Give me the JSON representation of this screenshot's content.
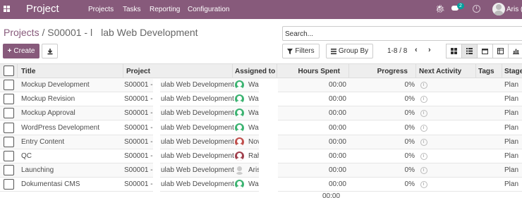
{
  "navbar": {
    "brand": "Project",
    "menu": [
      {
        "label": "Projects"
      },
      {
        "label": "Tasks"
      },
      {
        "label": "Reporting"
      },
      {
        "label": "Configuration"
      }
    ],
    "message_count": "2",
    "user": "Aris (",
    "color": "#875a7b"
  },
  "breadcrumb": {
    "parent": "Projects",
    "separator": "/",
    "current_a": "S00001 - l",
    "current_b": "lab Web Development"
  },
  "search": {
    "placeholder": "Search..."
  },
  "toolbar": {
    "create_label": "Create",
    "filters_label": "Filters",
    "groupby_label": "Group By",
    "pager": "1-8 / 8"
  },
  "table": {
    "columns": {
      "title": "Title",
      "project": "Project",
      "assigned": "Assigned to",
      "hours": "Hours Spent",
      "progress": "Progress",
      "next_activity": "Next Activity",
      "tags": "Tags",
      "stage": "Stage"
    },
    "rows": [
      {
        "title": "Mockup Development",
        "project_a": "S00001 -",
        "project_b": "ulab Web Development",
        "assigned": "Wal",
        "avatar_color": "#3cb371",
        "hours": "00:00",
        "progress": "0%",
        "stage": "Plan"
      },
      {
        "title": "Mockup Revision",
        "project_a": "S00001 -",
        "project_b": "ulab Web Development",
        "assigned": "Wal",
        "avatar_color": "#3cb371",
        "hours": "00:00",
        "progress": "0%",
        "stage": "Plan"
      },
      {
        "title": "Mockup Approval",
        "project_a": "S00001 -",
        "project_b": "ulab Web Development",
        "assigned": "Wal",
        "avatar_color": "#3cb371",
        "hours": "00:00",
        "progress": "0%",
        "stage": "Plan"
      },
      {
        "title": "WordPress Development",
        "project_a": "S00001 -",
        "project_b": "ulab Web Development",
        "assigned": "Wal",
        "avatar_color": "#3cb371",
        "hours": "00:00",
        "progress": "0%",
        "stage": "Plan"
      },
      {
        "title": "Entry Content",
        "project_a": "S00001 -",
        "project_b": "ulab Web Development",
        "assigned": "Nov",
        "avatar_color": "#c0504d",
        "hours": "00:00",
        "progress": "0%",
        "stage": "Plan"
      },
      {
        "title": "QC",
        "project_a": "S00001 -",
        "project_b": "ulab Web Development",
        "assigned": "Rah",
        "avatar_color": "#a0404d",
        "hours": "00:00",
        "progress": "0%",
        "stage": "Plan"
      },
      {
        "title": "Launching",
        "project_a": "S00001 -",
        "project_b": "ulab Web Development",
        "assigned": "Aris",
        "avatar_color": "",
        "hours": "00:00",
        "progress": "0%",
        "stage": "Plan"
      },
      {
        "title": "Dokumentasi CMS",
        "project_a": "S00001 -",
        "project_b": "ulab Web Development",
        "assigned": "Wal",
        "avatar_color": "#3cb371",
        "hours": "00:00",
        "progress": "0%",
        "stage": "Plan"
      }
    ],
    "total_hours": "00:00"
  }
}
